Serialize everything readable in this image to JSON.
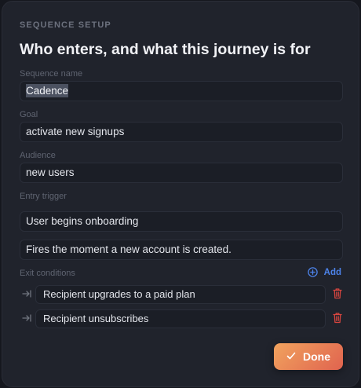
{
  "dialog": {
    "eyebrow": "SEQUENCE SETUP",
    "title": "Who enters, and what this journey is for"
  },
  "fields": {
    "sequence_name": {
      "label": "Sequence name",
      "value": "Cadence"
    },
    "goal": {
      "label": "Goal",
      "value": "activate new signups"
    },
    "audience": {
      "label": "Audience",
      "value": "new users"
    },
    "entry_trigger": {
      "label": "Entry trigger",
      "value": "User begins onboarding",
      "description": "Fires the moment a new account is created."
    }
  },
  "exit_conditions": {
    "label": "Exit conditions",
    "add_label": "Add",
    "items": [
      {
        "text": "Recipient upgrades to a paid plan"
      },
      {
        "text": "Recipient unsubscribes"
      }
    ]
  },
  "actions": {
    "done_label": "Done"
  },
  "icons": {
    "add": "plus-circle-icon",
    "exit": "exit-arrow-icon",
    "delete": "trash-icon",
    "done": "check-icon"
  },
  "colors": {
    "accent_blue": "#4d83ea",
    "delete_red": "#d6453f",
    "done_gradient_start": "#f1a35e",
    "done_gradient_end": "#e0634f"
  }
}
